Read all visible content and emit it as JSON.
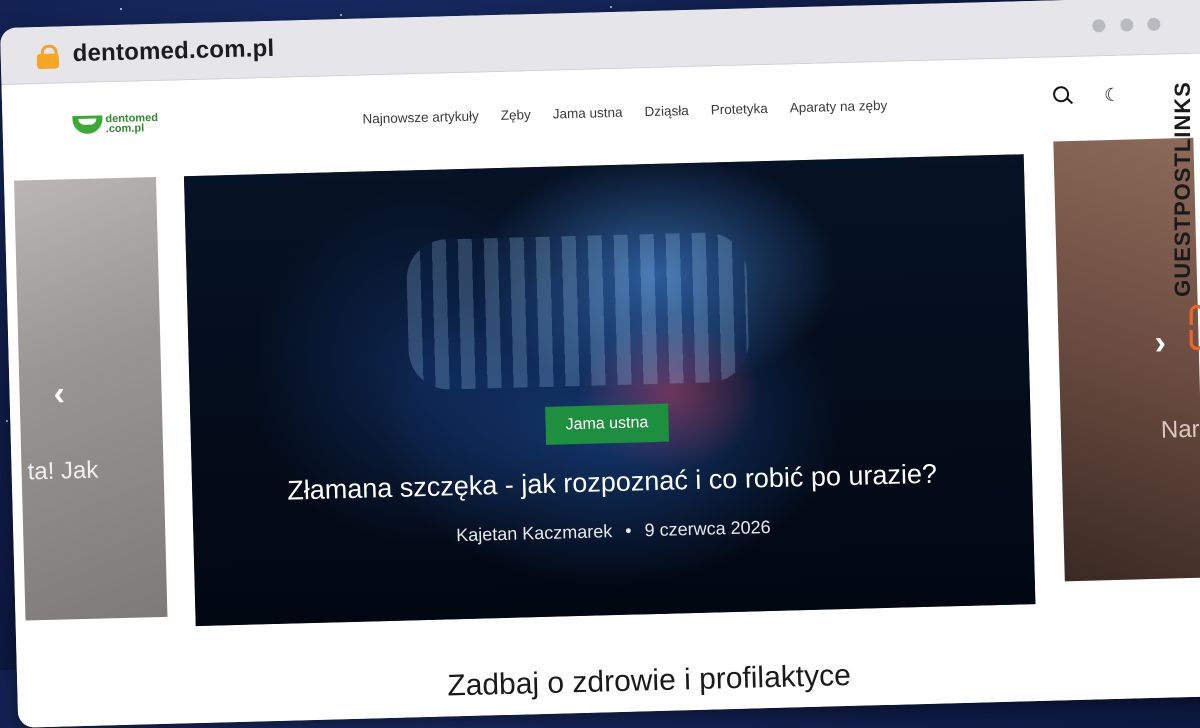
{
  "browser": {
    "url_domain": "dentomed.com.pl"
  },
  "site": {
    "logo": {
      "line1": "dentomed",
      "line2": ".com.pl"
    },
    "nav": [
      "Najnowsze artykuły",
      "Zęby",
      "Jama ustna",
      "Dziąsła",
      "Protetyka",
      "Aparaty na zęby"
    ],
    "icons": {
      "search": "search-icon",
      "theme": "moon-icon",
      "prev": "chevron-left-icon",
      "next": "chevron-right-icon"
    }
  },
  "carousel": {
    "left_partial_title": "ta! Jak",
    "right_partial_title": "Nar",
    "prev_glyph": "‹",
    "next_glyph": "›",
    "active": {
      "category": "Jama ustna",
      "title": "Złamana szczęka - jak rozpoznać i co robić po urazie?",
      "author": "Kajetan Kaczmarek",
      "separator": "•",
      "date": "9 czerwca 2026"
    }
  },
  "below": {
    "heading_partial": "Zadbaj o zdrowie i profilaktyce"
  },
  "watermark": {
    "text": "GUESTPOSTLINKS",
    "color": "#f06423"
  }
}
